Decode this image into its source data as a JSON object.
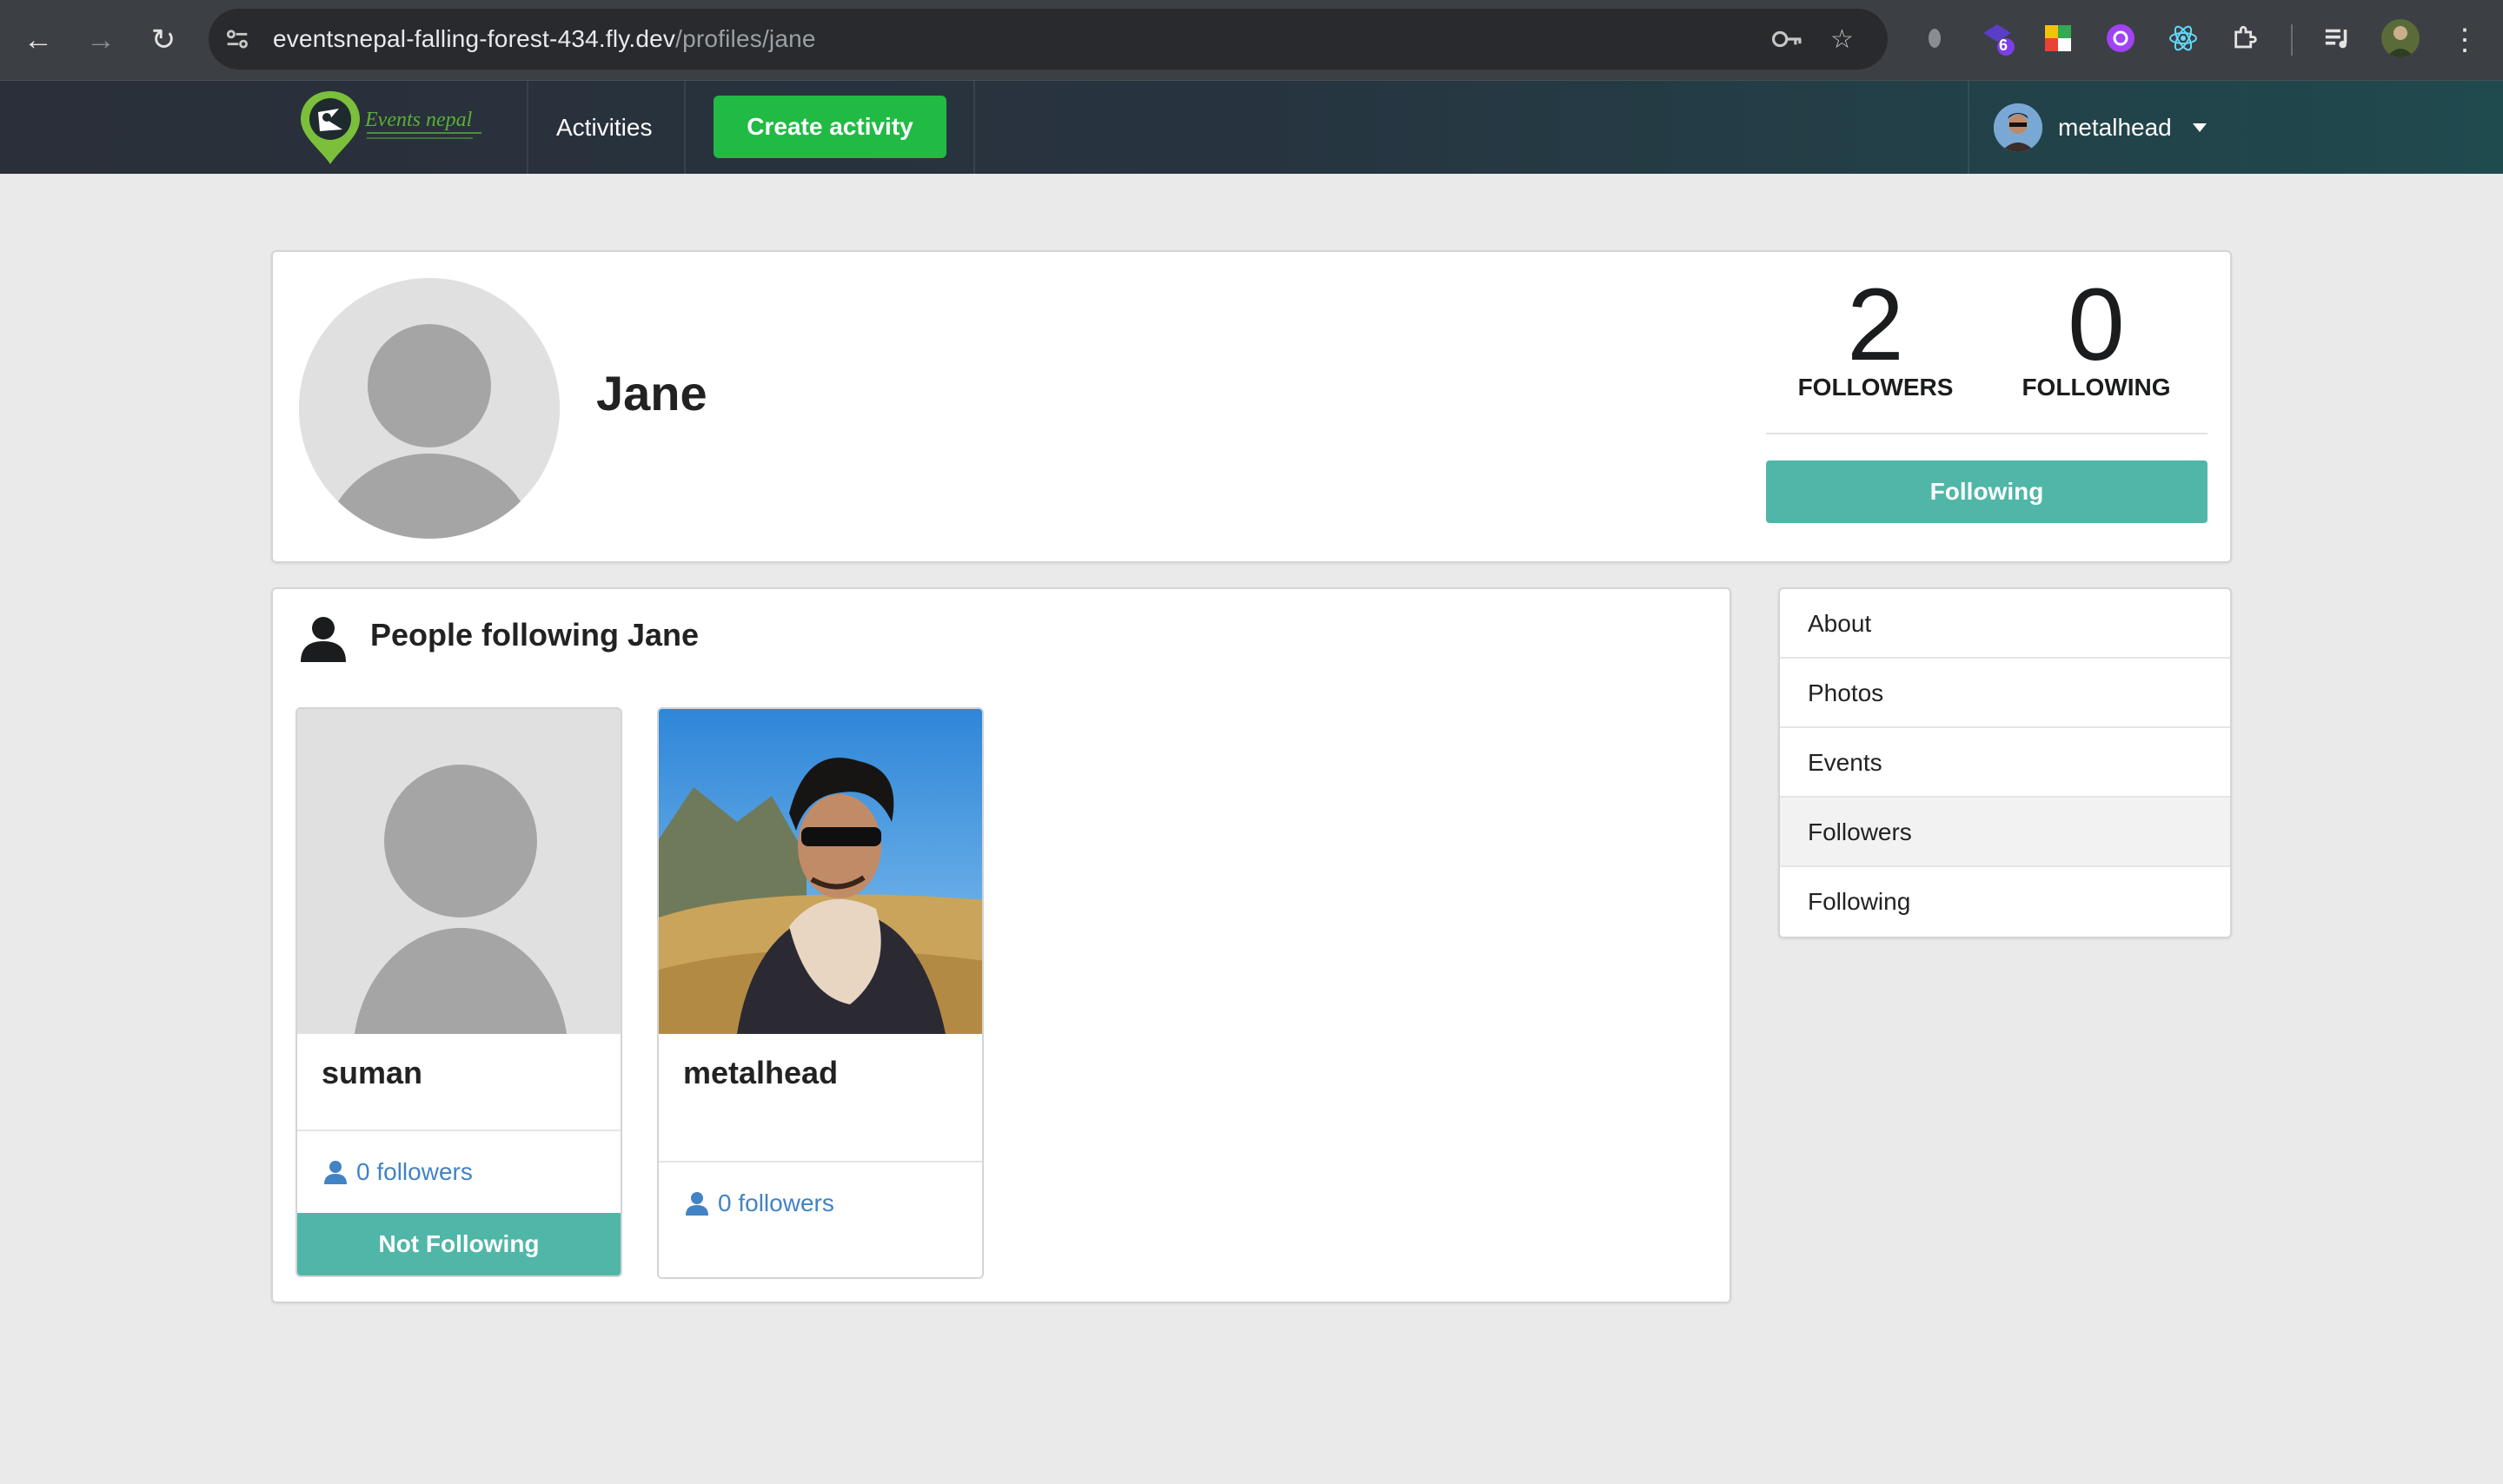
{
  "browser": {
    "url_host": "eventsnepal-falling-forest-434.fly.dev",
    "url_path": "/profiles/jane",
    "extension_badge": "6"
  },
  "nav": {
    "logo_text": "Events nepal",
    "activities_label": "Activities",
    "create_label": "Create activity",
    "username": "metalhead"
  },
  "profile": {
    "name": "Jane",
    "followers_count": "2",
    "followers_label": "FOLLOWERS",
    "following_count": "0",
    "following_label": "FOLLOWING",
    "follow_button_label": "Following"
  },
  "followers_panel": {
    "title": "People following Jane",
    "people": [
      {
        "name": "suman",
        "followers": "0 followers",
        "button": "Not Following"
      },
      {
        "name": "metalhead",
        "followers": "0 followers"
      }
    ]
  },
  "menu": {
    "items": [
      "About",
      "Photos",
      "Events",
      "Followers",
      "Following"
    ],
    "active": "Followers"
  },
  "colors": {
    "teal": "#4fb6a8",
    "green": "#21ba45",
    "link": "#4183c4"
  }
}
